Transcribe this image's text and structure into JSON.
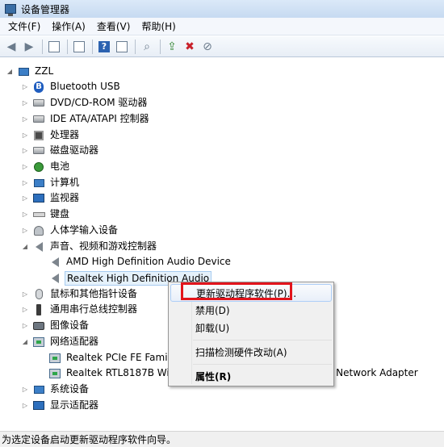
{
  "window": {
    "title": "设备管理器"
  },
  "menu": [
    "文件(F)",
    "操作(A)",
    "查看(V)",
    "帮助(H)"
  ],
  "tree": {
    "root": "ZZL",
    "categories": [
      "Bluetooth USB",
      "DVD/CD-ROM 驱动器",
      "IDE ATA/ATAPI 控制器",
      "处理器",
      "磁盘驱动器",
      "电池",
      "计算机",
      "监视器",
      "键盘",
      "人体学输入设备",
      "声音、视频和游戏控制器",
      "鼠标和其他指针设备",
      "通用串行总线控制器",
      "图像设备",
      "网络适配器",
      "系统设备",
      "显示适配器"
    ],
    "sound_children": [
      "AMD High Definition Audio Device",
      "Realtek High Definition Audio"
    ],
    "network_children": [
      "Realtek PCIe FE Family Controller",
      "Realtek RTL8187B Wireless 802.11b/g 54Mbps USB 2.0 Network Adapter"
    ]
  },
  "context_menu": [
    "更新驱动程序软件(P)...",
    "禁用(D)",
    "卸载(U)",
    "扫描检测硬件改动(A)",
    "属性(R)"
  ],
  "status": "为选定设备启动更新驱动程序软件向导。",
  "colors": {
    "highlight_box": "#e2141c",
    "selection": "#e5f1fb"
  }
}
